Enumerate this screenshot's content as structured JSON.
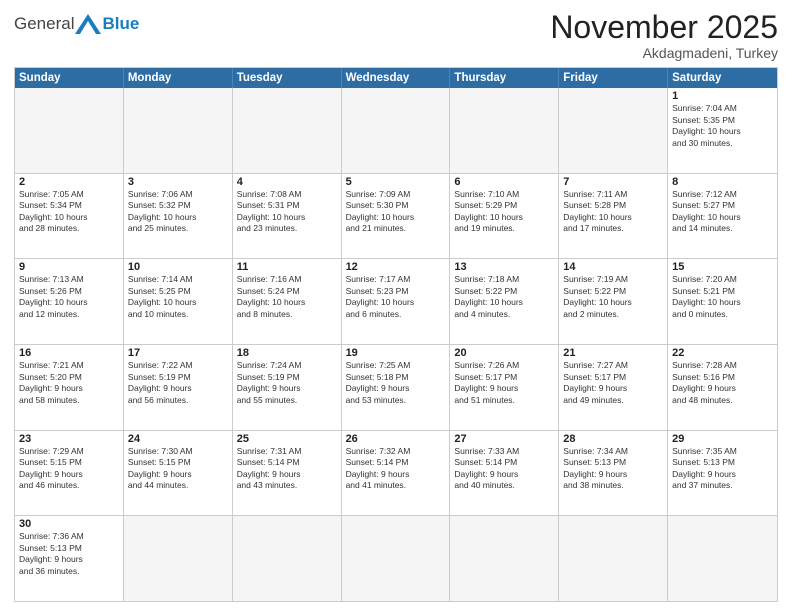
{
  "header": {
    "logo_general": "General",
    "logo_blue": "Blue",
    "month_title": "November 2025",
    "location": "Akdagmadeni, Turkey"
  },
  "weekdays": [
    "Sunday",
    "Monday",
    "Tuesday",
    "Wednesday",
    "Thursday",
    "Friday",
    "Saturday"
  ],
  "rows": [
    [
      {
        "day": "",
        "info": ""
      },
      {
        "day": "",
        "info": ""
      },
      {
        "day": "",
        "info": ""
      },
      {
        "day": "",
        "info": ""
      },
      {
        "day": "",
        "info": ""
      },
      {
        "day": "",
        "info": ""
      },
      {
        "day": "1",
        "info": "Sunrise: 7:04 AM\nSunset: 5:35 PM\nDaylight: 10 hours\nand 30 minutes."
      }
    ],
    [
      {
        "day": "2",
        "info": "Sunrise: 7:05 AM\nSunset: 5:34 PM\nDaylight: 10 hours\nand 28 minutes."
      },
      {
        "day": "3",
        "info": "Sunrise: 7:06 AM\nSunset: 5:32 PM\nDaylight: 10 hours\nand 25 minutes."
      },
      {
        "day": "4",
        "info": "Sunrise: 7:08 AM\nSunset: 5:31 PM\nDaylight: 10 hours\nand 23 minutes."
      },
      {
        "day": "5",
        "info": "Sunrise: 7:09 AM\nSunset: 5:30 PM\nDaylight: 10 hours\nand 21 minutes."
      },
      {
        "day": "6",
        "info": "Sunrise: 7:10 AM\nSunset: 5:29 PM\nDaylight: 10 hours\nand 19 minutes."
      },
      {
        "day": "7",
        "info": "Sunrise: 7:11 AM\nSunset: 5:28 PM\nDaylight: 10 hours\nand 17 minutes."
      },
      {
        "day": "8",
        "info": "Sunrise: 7:12 AM\nSunset: 5:27 PM\nDaylight: 10 hours\nand 14 minutes."
      }
    ],
    [
      {
        "day": "9",
        "info": "Sunrise: 7:13 AM\nSunset: 5:26 PM\nDaylight: 10 hours\nand 12 minutes."
      },
      {
        "day": "10",
        "info": "Sunrise: 7:14 AM\nSunset: 5:25 PM\nDaylight: 10 hours\nand 10 minutes."
      },
      {
        "day": "11",
        "info": "Sunrise: 7:16 AM\nSunset: 5:24 PM\nDaylight: 10 hours\nand 8 minutes."
      },
      {
        "day": "12",
        "info": "Sunrise: 7:17 AM\nSunset: 5:23 PM\nDaylight: 10 hours\nand 6 minutes."
      },
      {
        "day": "13",
        "info": "Sunrise: 7:18 AM\nSunset: 5:22 PM\nDaylight: 10 hours\nand 4 minutes."
      },
      {
        "day": "14",
        "info": "Sunrise: 7:19 AM\nSunset: 5:22 PM\nDaylight: 10 hours\nand 2 minutes."
      },
      {
        "day": "15",
        "info": "Sunrise: 7:20 AM\nSunset: 5:21 PM\nDaylight: 10 hours\nand 0 minutes."
      }
    ],
    [
      {
        "day": "16",
        "info": "Sunrise: 7:21 AM\nSunset: 5:20 PM\nDaylight: 9 hours\nand 58 minutes."
      },
      {
        "day": "17",
        "info": "Sunrise: 7:22 AM\nSunset: 5:19 PM\nDaylight: 9 hours\nand 56 minutes."
      },
      {
        "day": "18",
        "info": "Sunrise: 7:24 AM\nSunset: 5:19 PM\nDaylight: 9 hours\nand 55 minutes."
      },
      {
        "day": "19",
        "info": "Sunrise: 7:25 AM\nSunset: 5:18 PM\nDaylight: 9 hours\nand 53 minutes."
      },
      {
        "day": "20",
        "info": "Sunrise: 7:26 AM\nSunset: 5:17 PM\nDaylight: 9 hours\nand 51 minutes."
      },
      {
        "day": "21",
        "info": "Sunrise: 7:27 AM\nSunset: 5:17 PM\nDaylight: 9 hours\nand 49 minutes."
      },
      {
        "day": "22",
        "info": "Sunrise: 7:28 AM\nSunset: 5:16 PM\nDaylight: 9 hours\nand 48 minutes."
      }
    ],
    [
      {
        "day": "23",
        "info": "Sunrise: 7:29 AM\nSunset: 5:15 PM\nDaylight: 9 hours\nand 46 minutes."
      },
      {
        "day": "24",
        "info": "Sunrise: 7:30 AM\nSunset: 5:15 PM\nDaylight: 9 hours\nand 44 minutes."
      },
      {
        "day": "25",
        "info": "Sunrise: 7:31 AM\nSunset: 5:14 PM\nDaylight: 9 hours\nand 43 minutes."
      },
      {
        "day": "26",
        "info": "Sunrise: 7:32 AM\nSunset: 5:14 PM\nDaylight: 9 hours\nand 41 minutes."
      },
      {
        "day": "27",
        "info": "Sunrise: 7:33 AM\nSunset: 5:14 PM\nDaylight: 9 hours\nand 40 minutes."
      },
      {
        "day": "28",
        "info": "Sunrise: 7:34 AM\nSunset: 5:13 PM\nDaylight: 9 hours\nand 38 minutes."
      },
      {
        "day": "29",
        "info": "Sunrise: 7:35 AM\nSunset: 5:13 PM\nDaylight: 9 hours\nand 37 minutes."
      }
    ],
    [
      {
        "day": "30",
        "info": "Sunrise: 7:36 AM\nSunset: 5:13 PM\nDaylight: 9 hours\nand 36 minutes."
      },
      {
        "day": "",
        "info": ""
      },
      {
        "day": "",
        "info": ""
      },
      {
        "day": "",
        "info": ""
      },
      {
        "day": "",
        "info": ""
      },
      {
        "day": "",
        "info": ""
      },
      {
        "day": "",
        "info": ""
      }
    ]
  ]
}
